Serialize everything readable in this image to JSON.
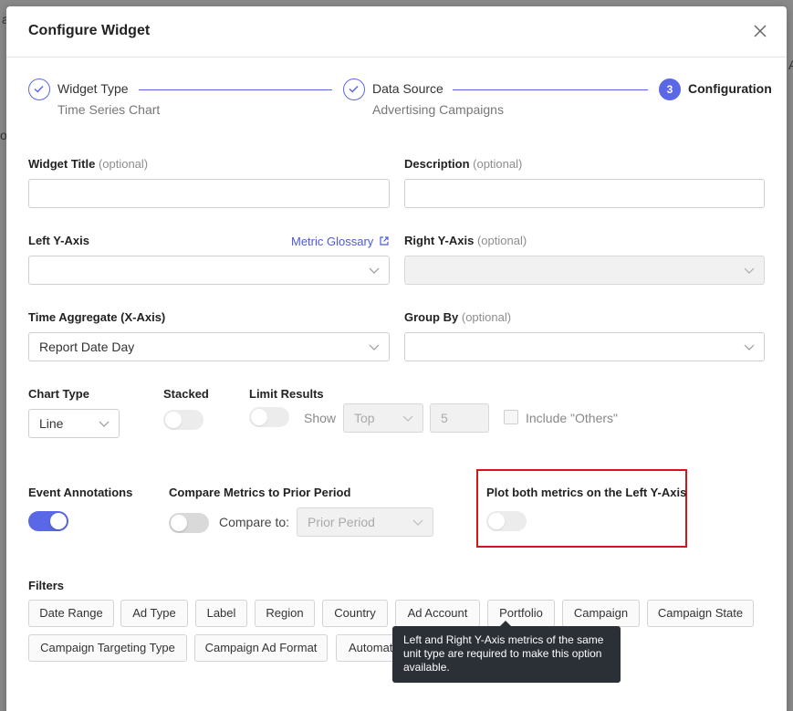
{
  "background": {
    "left_text": "a",
    "left_text2": "o",
    "right_text": "A"
  },
  "modal": {
    "title": "Configure Widget"
  },
  "stepper": [
    {
      "title": "Widget Type",
      "subtitle": "Time Series Chart",
      "state": "done"
    },
    {
      "title": "Data Source",
      "subtitle": "Advertising Campaigns",
      "state": "done"
    },
    {
      "number": "3",
      "title": "Configuration",
      "state": "active"
    }
  ],
  "form": {
    "widget_title_label": "Widget Title",
    "description_label": "Description",
    "optional": "(optional)",
    "left_y_label": "Left Y-Axis",
    "metric_glossary": "Metric Glossary",
    "right_y_label": "Right Y-Axis",
    "time_aggregate_label": "Time Aggregate (X-Axis)",
    "time_aggregate_value": "Report Date Day",
    "group_by_label": "Group By",
    "chart_type_label": "Chart Type",
    "chart_type_value": "Line",
    "stacked_label": "Stacked",
    "limit_results_label": "Limit Results",
    "show_label": "Show",
    "top_value": "Top",
    "limit_number": "5",
    "include_others": "Include \"Others\"",
    "event_annotations_label": "Event Annotations",
    "compare_label": "Compare Metrics to Prior Period",
    "compare_to_label": "Compare to:",
    "compare_to_value": "Prior Period",
    "plot_both_label": "Plot both metrics on the Left Y-Axis"
  },
  "filters": {
    "label": "Filters",
    "chips": [
      "Date Range",
      "Ad Type",
      "Label",
      "Region",
      "Country",
      "Ad Account",
      "Portfolio",
      "Campaign",
      "Campaign State",
      "Campaign Targeting Type",
      "Campaign Ad Format",
      "Automat"
    ]
  },
  "tooltip": {
    "text": "Left and Right Y-Axis metrics of the same unit type are required to make this option available."
  },
  "colors": {
    "accent": "#5a67e6",
    "highlight": "#d6141c",
    "tooltip_bg": "#2b2f36"
  }
}
